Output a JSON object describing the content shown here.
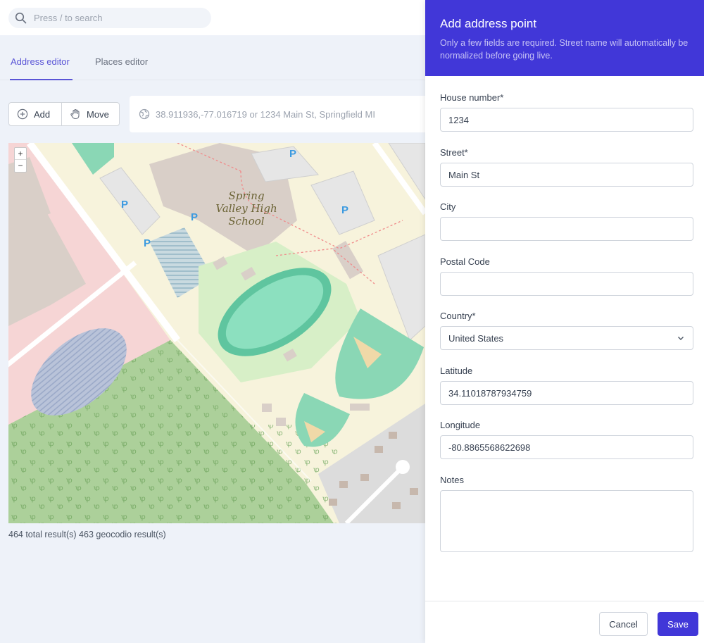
{
  "search": {
    "placeholder": "Press / to search",
    "icon": "search-icon"
  },
  "tabs": [
    {
      "label": "Address editor",
      "active": true
    },
    {
      "label": "Places editor",
      "active": false
    }
  ],
  "toolbar": {
    "add_label": "Add",
    "add_icon": "plus-circle-icon",
    "move_label": "Move",
    "move_icon": "hand-icon"
  },
  "coordinate_input": {
    "placeholder": "38.911936,-77.016719 or 1234 Main St, Springfield MI",
    "icon": "globe-icon"
  },
  "map": {
    "zoom_in": "+",
    "zoom_out": "−",
    "labels": [
      "Spring",
      "Valley High",
      "School"
    ],
    "parking_label": "P"
  },
  "results_text": "464 total result(s) 463 geocodio result(s)",
  "panel": {
    "title": "Add address point",
    "description": "Only a few fields are required. Street name will automatically be normalized before going live.",
    "fields": {
      "house_number": {
        "label": "House number*",
        "value": "1234"
      },
      "street": {
        "label": "Street*",
        "value": "Main St"
      },
      "city": {
        "label": "City",
        "value": ""
      },
      "postal_code": {
        "label": "Postal Code",
        "value": ""
      },
      "country": {
        "label": "Country*",
        "value": "United States"
      },
      "latitude": {
        "label": "Latitude",
        "value": "34.11018787934759"
      },
      "longitude": {
        "label": "Longitude",
        "value": "-80.8865568622698"
      },
      "notes": {
        "label": "Notes",
        "value": ""
      }
    },
    "cancel_label": "Cancel",
    "save_label": "Save"
  },
  "colors": {
    "accent": "#4137d8",
    "tab_active": "#5a55d6",
    "page_bg": "#eef2f9"
  }
}
